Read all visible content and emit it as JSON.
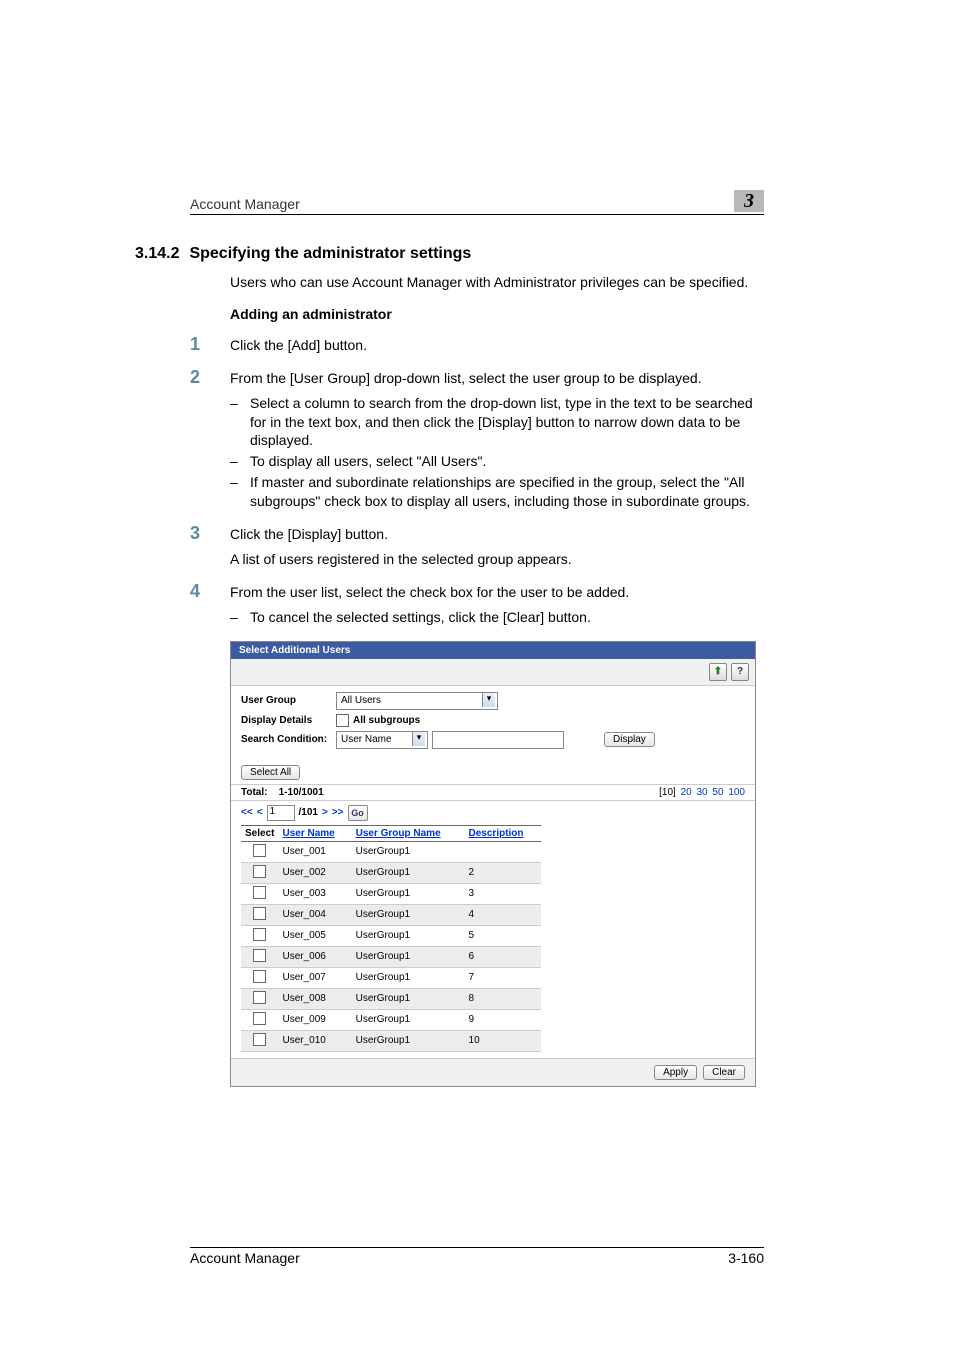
{
  "header": {
    "title": "Account Manager",
    "chapter": "3"
  },
  "section": {
    "number": "3.14.2",
    "title": "Specifying the administrator settings",
    "intro": "Users who can use Account Manager with Administrator privileges can be specified.",
    "subhead": "Adding an administrator"
  },
  "steps": [
    {
      "text": "Click the [Add] button."
    },
    {
      "text": "From the [User Group] drop-down list, select the user group to be displayed.",
      "subs": [
        "Select a column to search from the drop-down list, type in the text to be searched for in the text box, and then click the [Display] button to narrow down data to be displayed.",
        "To display all users, select \"All Users\".",
        "If master and subordinate relationships are specified in the group, select the \"All subgroups\" check box to display all users, including those in subordinate groups."
      ]
    },
    {
      "text": "Click the [Display] button.",
      "follow": "A list of users registered in the selected group appears."
    },
    {
      "text": "From the user list, select the check box for the user to be added.",
      "subs": [
        "To cancel the selected settings, click the [Clear] button."
      ]
    }
  ],
  "panel": {
    "title": "Select Additional Users",
    "icons": {
      "up": "⬆",
      "help": "?"
    },
    "filters": {
      "userGroupLabel": "User Group",
      "userGroupValue": "All Users",
      "displayDetailsLabel": "Display Details",
      "allSubgroupsLabel": "All subgroups",
      "searchConditionLabel": "Search Condition:",
      "searchFieldValue": "User Name",
      "displayBtn": "Display"
    },
    "selectAllBtn": "Select All",
    "totalLabel": "Total:",
    "totalValue": "1-10/1001",
    "pageSize": {
      "current": "[10]",
      "opts": [
        "20",
        "30",
        "50",
        "100"
      ]
    },
    "pager": {
      "first": "<<",
      "prev": "<",
      "current": "1",
      "totalPages": "/101",
      "next": ">",
      "last": ">>",
      "go": "Go"
    },
    "columns": {
      "select": "Select",
      "userName": "User Name",
      "userGroupName": "User Group Name",
      "description": "Description"
    },
    "rows": [
      {
        "user": "User_001",
        "group": "UserGroup1",
        "desc": ""
      },
      {
        "user": "User_002",
        "group": "UserGroup1",
        "desc": "2"
      },
      {
        "user": "User_003",
        "group": "UserGroup1",
        "desc": "3"
      },
      {
        "user": "User_004",
        "group": "UserGroup1",
        "desc": "4"
      },
      {
        "user": "User_005",
        "group": "UserGroup1",
        "desc": "5"
      },
      {
        "user": "User_006",
        "group": "UserGroup1",
        "desc": "6"
      },
      {
        "user": "User_007",
        "group": "UserGroup1",
        "desc": "7"
      },
      {
        "user": "User_008",
        "group": "UserGroup1",
        "desc": "8"
      },
      {
        "user": "User_009",
        "group": "UserGroup1",
        "desc": "9"
      },
      {
        "user": "User_010",
        "group": "UserGroup1",
        "desc": "10"
      }
    ],
    "applyBtn": "Apply",
    "clearBtn": "Clear"
  },
  "footer": {
    "left": "Account Manager",
    "right": "3-160"
  }
}
